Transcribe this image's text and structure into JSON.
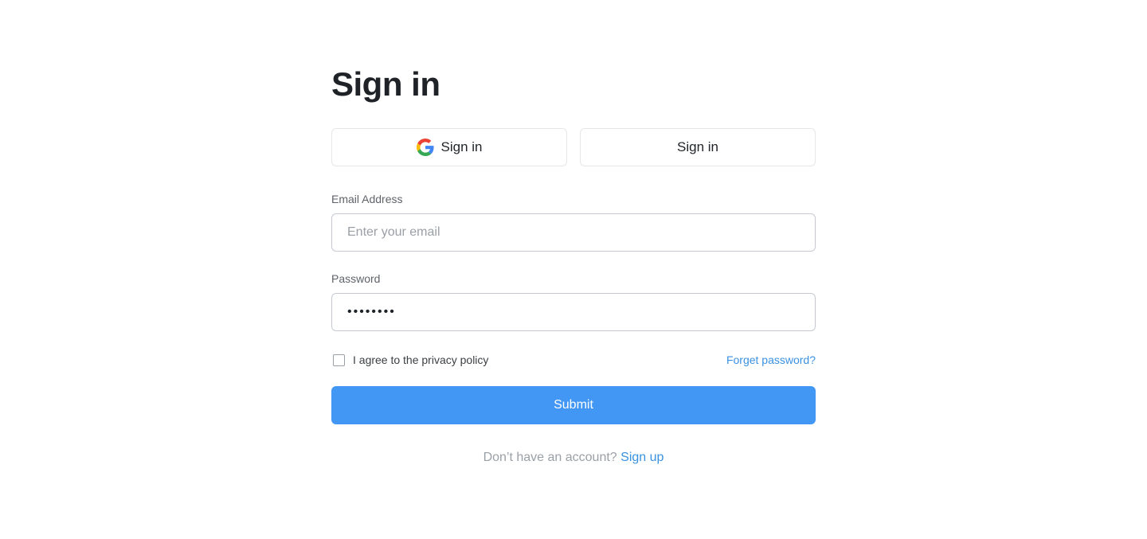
{
  "page": {
    "title": "Sign in"
  },
  "social": {
    "google_label": "Sign in",
    "google_icon": "google-icon",
    "second_label": "Sign in"
  },
  "form": {
    "email_label": "Email Address",
    "email_placeholder": "Enter your email",
    "email_value": "",
    "password_label": "Password",
    "password_value": "••••••••",
    "agree_label": "I agree to the privacy policy",
    "agree_checked": false,
    "forgot_label": "Forget password?",
    "submit_label": "Submit"
  },
  "footer": {
    "prompt": "Don’t have an account?",
    "signup_label": "Sign up"
  },
  "colors": {
    "accent": "#4296f4",
    "link": "#3a91e0",
    "text": "#1f2328",
    "muted": "#9aa0a6",
    "border": "#c6c9cf"
  }
}
